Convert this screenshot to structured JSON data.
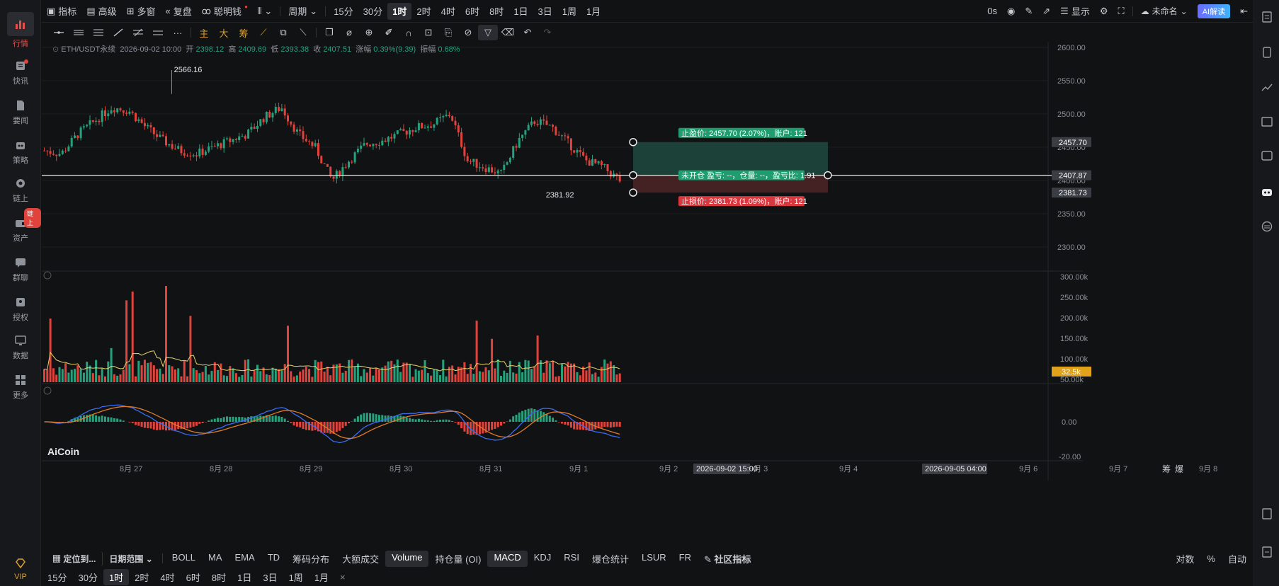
{
  "sidebar": {
    "items": [
      {
        "label": "行情"
      },
      {
        "label": "快讯"
      },
      {
        "label": "要闻"
      },
      {
        "label": "策略"
      },
      {
        "label": "链上"
      },
      {
        "label": "资产",
        "badge": "链上"
      },
      {
        "label": "群聊"
      },
      {
        "label": "授权"
      },
      {
        "label": "数据"
      },
      {
        "label": "更多"
      }
    ],
    "vip": "VIP"
  },
  "toolbar": {
    "indicator": "指标",
    "advanced": "高级",
    "multi_window": "多窗",
    "replay": "复盘",
    "smart_money": "聪明钱",
    "period": "周期",
    "intervals": [
      "15分",
      "30分",
      "1时",
      "2时",
      "4时",
      "6时",
      "8时",
      "1日",
      "3日",
      "1周",
      "1月"
    ],
    "selected_interval": "1时",
    "countdown": "0s",
    "display": "显示",
    "unnamed": "未命名",
    "ai_button": "AI解读"
  },
  "info": {
    "symbol": "ETH/USDT永续",
    "datetime": "2026-09-02 10:00",
    "open_label": "开",
    "open": "2398.12",
    "high_label": "高",
    "high": "2409.69",
    "low_label": "低",
    "low": "2393.38",
    "close_label": "收",
    "close": "2407.51",
    "change_label": "涨幅",
    "change": "0.39%(9.39)",
    "amp_label": "振幅",
    "amp": "0.68%"
  },
  "price_axis": [
    "2600.00",
    "2550.00",
    "2500.00",
    "2450.00",
    "2400.00",
    "2350.00",
    "2300.00"
  ],
  "price_tags": {
    "tp": "2457.70",
    "current": "2407.87",
    "sl": "2381.73"
  },
  "annotations": {
    "high": "2566.16",
    "low": "2381.92"
  },
  "position_tool": {
    "take_profit": "止盈价: 2457.70 (2.07%)，账户: 121",
    "status": "未开仓 盈亏: --，仓量: --，盈亏比: 1.91",
    "stop_loss": "止损价: 2381.73 (1.09%)，账户: 121"
  },
  "volume_axis": [
    "300.00k",
    "250.00k",
    "200.00k",
    "150.00k",
    "100.00k",
    "50.00k"
  ],
  "volume_tag": "32.5k",
  "macd_axis": [
    "0.00",
    "-20.00"
  ],
  "time_axis": [
    "8月 27",
    "8月 28",
    "8月 29",
    "8月 30",
    "8月 31",
    "9月 1",
    "9月 2",
    "9月 3",
    "9月 4",
    "9月 5",
    "9月 6",
    "9月 7",
    "9月 8"
  ],
  "time_tags": [
    "2026-09-02 15:00",
    "2026-09-05 04:00"
  ],
  "corner": [
    "筹",
    "爆"
  ],
  "logo": "AiCoin",
  "bottom_tools": {
    "locate": "定位到...",
    "date_range": "日期范围",
    "indicators": [
      "BOLL",
      "MA",
      "EMA",
      "TD",
      "筹码分布",
      "大额成交",
      "Volume",
      "持仓量 (OI)",
      "MACD",
      "KDJ",
      "RSI",
      "爆仓统计",
      "LSUR",
      "FR"
    ],
    "community": "社区指标",
    "log": "对数",
    "percent": "%",
    "auto": "自动"
  },
  "period_bar": [
    "15分",
    "30分",
    "1时",
    "2时",
    "4时",
    "6时",
    "8时",
    "1日",
    "3日",
    "1周",
    "1月"
  ],
  "period_selected": "1时",
  "colors": {
    "up": "#26a17b",
    "down": "#e0433c",
    "bg": "#111214",
    "accent": "#e0433c"
  }
}
